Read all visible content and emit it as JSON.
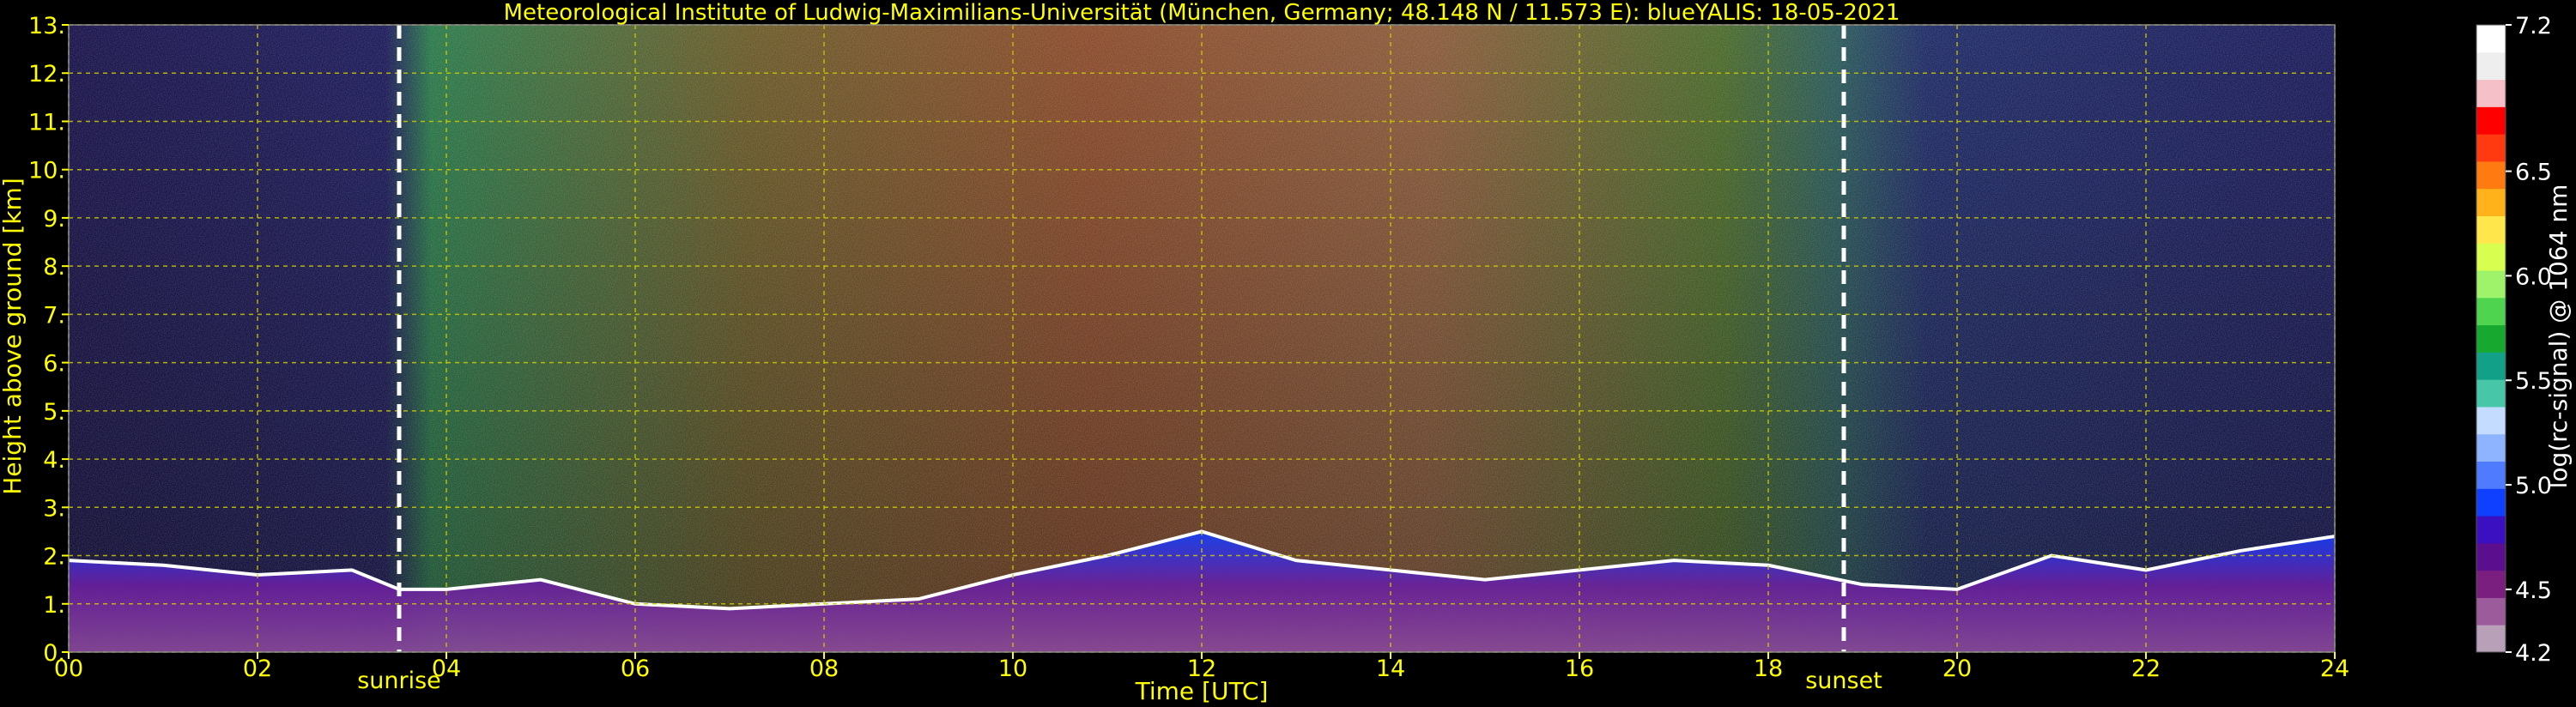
{
  "chart_data": {
    "type": "heatmap",
    "title": "Meteorological Institute of Ludwig-Maximilians-Universität (München, Germany; 48.148 N / 11.573 E):    blueYALIS: 18-05-2021",
    "xlabel": "Time [UTC]",
    "ylabel": "Height above ground [km]",
    "colorbar_label": "log(rc-signal) @ 1064 nm",
    "xlim": [
      0,
      24
    ],
    "ylim": [
      0,
      13
    ],
    "clim": [
      4.2,
      7.2
    ],
    "x_ticks": [
      0,
      2,
      4,
      6,
      8,
      10,
      12,
      14,
      16,
      18,
      20,
      22,
      24
    ],
    "x_tick_labels": [
      "00",
      "02",
      "04",
      "06",
      "08",
      "10",
      "12",
      "14",
      "16",
      "18",
      "20",
      "22",
      "24"
    ],
    "y_ticks": [
      0,
      1,
      2,
      3,
      4,
      5,
      6,
      7,
      8,
      9,
      10,
      11,
      12,
      13
    ],
    "y_tick_labels": [
      "0.",
      "1.",
      "2.",
      "3.",
      "4.",
      "5.",
      "6.",
      "7.",
      "8.",
      "9.",
      "10.",
      "11.",
      "12.",
      "13."
    ],
    "colorbar_ticks": [
      4.2,
      4.5,
      5.0,
      5.5,
      6.0,
      6.5,
      7.2
    ],
    "colorbar_tick_labels": [
      "4.2",
      "4.5",
      "5.0",
      "5.5",
      "6.0",
      "6.5",
      "7.2"
    ],
    "grid": true,
    "annotations": [
      {
        "text": "sunrise",
        "x": 3.5
      },
      {
        "text": "sunset",
        "x": 18.8
      }
    ],
    "boundary_layer_top_km": [
      [
        0,
        1.9
      ],
      [
        1,
        1.8
      ],
      [
        2,
        1.6
      ],
      [
        3,
        1.7
      ],
      [
        3.5,
        1.3
      ],
      [
        4,
        1.3
      ],
      [
        5,
        1.5
      ],
      [
        6,
        1.0
      ],
      [
        7,
        0.9
      ],
      [
        8,
        1.0
      ],
      [
        9,
        1.1
      ],
      [
        10,
        1.6
      ],
      [
        11,
        2.0
      ],
      [
        12,
        2.5
      ],
      [
        13,
        1.9
      ],
      [
        14,
        1.7
      ],
      [
        15,
        1.5
      ],
      [
        16,
        1.7
      ],
      [
        17,
        1.9
      ],
      [
        18,
        1.8
      ],
      [
        19,
        1.4
      ],
      [
        20,
        1.3
      ],
      [
        21,
        2.0
      ],
      [
        22,
        1.7
      ],
      [
        23,
        2.1
      ],
      [
        24,
        2.4
      ]
    ]
  },
  "colors": {
    "text": "#ffff00",
    "grid": "#cccc00",
    "marker": "#ffffff",
    "colormap": [
      "#b8a0b8",
      "#9c5c9c",
      "#7a1f7f",
      "#5b0f8f",
      "#3a10c0",
      "#1040ff",
      "#4f7cff",
      "#8fb4ff",
      "#c4dcff",
      "#47c6a8",
      "#13a089",
      "#17a82f",
      "#4fd44f",
      "#9ef36a",
      "#d8ff4f",
      "#ffe64a",
      "#ffb21a",
      "#ff7a10",
      "#ff3a10",
      "#ff0000",
      "#f5c0c8",
      "#eeeeee",
      "#ffffff"
    ]
  }
}
